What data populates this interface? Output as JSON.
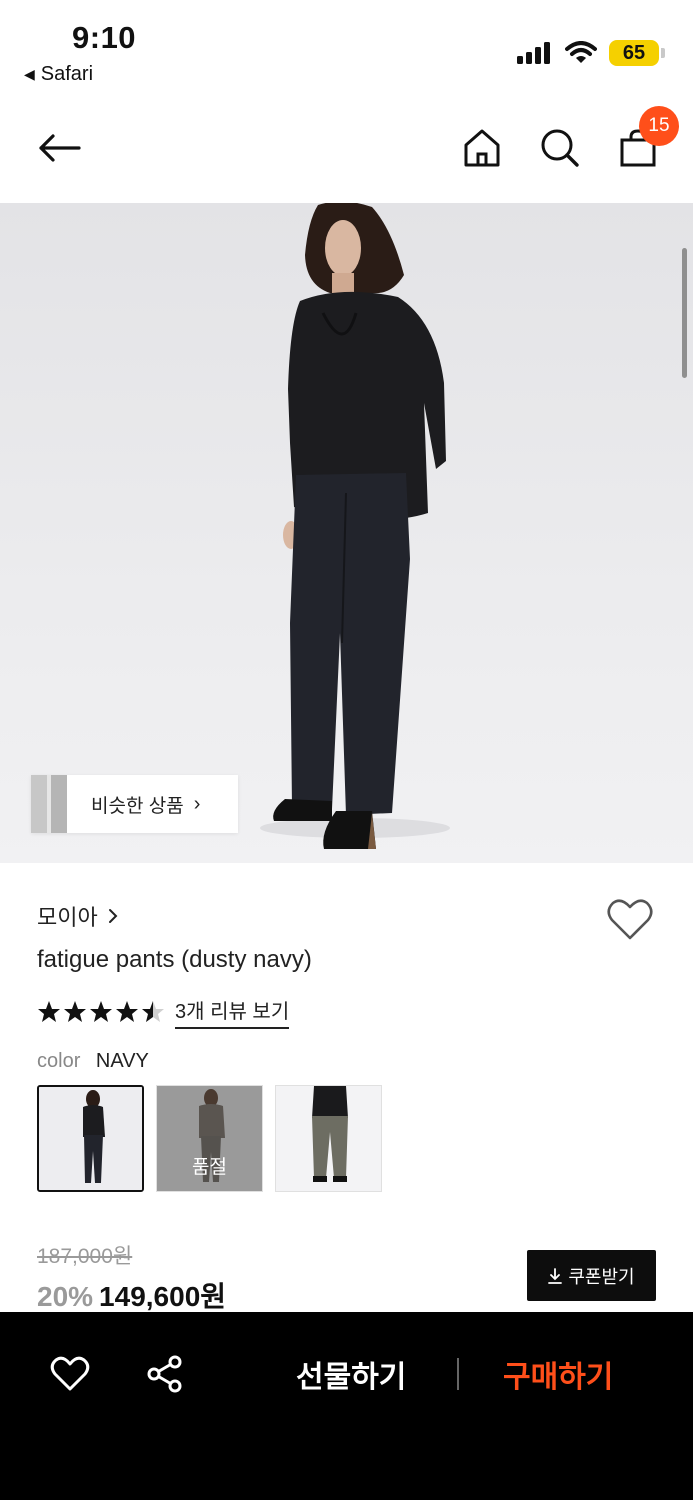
{
  "status_bar": {
    "time": "9:10",
    "back_app": "Safari",
    "battery": "65"
  },
  "nav": {
    "cart_count": "15",
    "icons": [
      "back-arrow-icon",
      "home-icon",
      "search-icon",
      "shopping-bag-icon"
    ]
  },
  "hero": {
    "similar_label": "비슷한 상품"
  },
  "product": {
    "brand": "모이아",
    "name": "fatigue pants (dusty navy)",
    "rating": 4.5,
    "review_link": "3개 리뷰 보기",
    "color_label": "color",
    "color_value": "NAVY",
    "swatches": [
      {
        "selected": true,
        "soldout": false
      },
      {
        "selected": false,
        "soldout": true,
        "label": "품절"
      },
      {
        "selected": false,
        "soldout": false
      }
    ]
  },
  "price": {
    "original": "187,000원",
    "discount": "20%",
    "final": "149,600원",
    "coupon_label": "쿠폰받기"
  },
  "bottom_bar": {
    "gift_label": "선물하기",
    "buy_label": "구매하기",
    "buy_color": "#ff4f1a"
  },
  "colors": {
    "accent": "#ff4f1a",
    "battery": "#f5d000"
  }
}
